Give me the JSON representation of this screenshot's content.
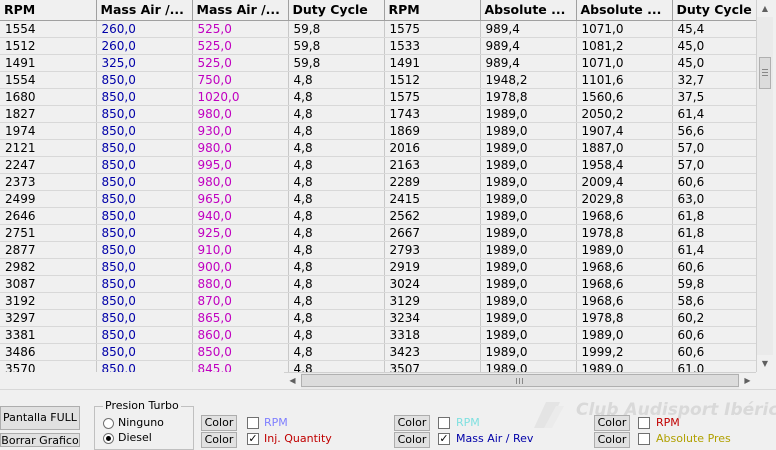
{
  "columns": [
    "RPM",
    "Mass Air /...",
    "Mass Air /...",
    "Duty Cycle",
    "RPM",
    "Absolute ...",
    "Absolute ...",
    "Duty Cycle"
  ],
  "rows": [
    [
      "1554",
      "260,0",
      "525,0",
      "59,8",
      "1575",
      "989,4",
      "1071,0",
      "45,4"
    ],
    [
      "1512",
      "260,0",
      "525,0",
      "59,8",
      "1533",
      "989,4",
      "1081,2",
      "45,0"
    ],
    [
      "1491",
      "325,0",
      "525,0",
      "59,8",
      "1491",
      "989,4",
      "1071,0",
      "45,0"
    ],
    [
      "1554",
      "850,0",
      "750,0",
      "4,8",
      "1512",
      "1948,2",
      "1101,6",
      "32,7"
    ],
    [
      "1680",
      "850,0",
      "1020,0",
      "4,8",
      "1575",
      "1978,8",
      "1560,6",
      "37,5"
    ],
    [
      "1827",
      "850,0",
      "980,0",
      "4,8",
      "1743",
      "1989,0",
      "2050,2",
      "61,4"
    ],
    [
      "1974",
      "850,0",
      "930,0",
      "4,8",
      "1869",
      "1989,0",
      "1907,4",
      "56,6"
    ],
    [
      "2121",
      "850,0",
      "980,0",
      "4,8",
      "2016",
      "1989,0",
      "1887,0",
      "57,0"
    ],
    [
      "2247",
      "850,0",
      "995,0",
      "4,8",
      "2163",
      "1989,0",
      "1958,4",
      "57,0"
    ],
    [
      "2373",
      "850,0",
      "980,0",
      "4,8",
      "2289",
      "1989,0",
      "2009,4",
      "60,6"
    ],
    [
      "2499",
      "850,0",
      "965,0",
      "4,8",
      "2415",
      "1989,0",
      "2029,8",
      "63,0"
    ],
    [
      "2646",
      "850,0",
      "940,0",
      "4,8",
      "2562",
      "1989,0",
      "1968,6",
      "61,8"
    ],
    [
      "2751",
      "850,0",
      "925,0",
      "4,8",
      "2667",
      "1989,0",
      "1978,8",
      "61,8"
    ],
    [
      "2877",
      "850,0",
      "910,0",
      "4,8",
      "2793",
      "1989,0",
      "1989,0",
      "61,4"
    ],
    [
      "2982",
      "850,0",
      "900,0",
      "4,8",
      "2919",
      "1989,0",
      "1968,6",
      "60,6"
    ],
    [
      "3087",
      "850,0",
      "880,0",
      "4,8",
      "3024",
      "1989,0",
      "1968,6",
      "59,8"
    ],
    [
      "3192",
      "850,0",
      "870,0",
      "4,8",
      "3129",
      "1989,0",
      "1968,6",
      "58,6"
    ],
    [
      "3297",
      "850,0",
      "865,0",
      "4,8",
      "3234",
      "1989,0",
      "1978,8",
      "60,2"
    ],
    [
      "3381",
      "850,0",
      "860,0",
      "4,8",
      "3318",
      "1989,0",
      "1989,0",
      "60,6"
    ],
    [
      "3486",
      "850,0",
      "850,0",
      "4,8",
      "3423",
      "1989,0",
      "1999,2",
      "60,6"
    ],
    [
      "3570",
      "850,0",
      "845,0",
      "4,8",
      "3507",
      "1989,0",
      "1989,0",
      "61,0"
    ]
  ],
  "column_colors": [
    "#000000",
    "#0000a8",
    "#c000c0",
    "#000000",
    "#000000",
    "#000000",
    "#000000",
    "#000000"
  ],
  "panel": {
    "pantalla_full": "Pantalla  FULL",
    "borrar_graficos": "Borrar Grafico",
    "presion_turbo": {
      "legend": "Presion Turbo",
      "options": [
        "Ninguno",
        "Diesel"
      ],
      "selected": "Diesel"
    },
    "series_controls": [
      {
        "color_button": "Color",
        "label": "RPM",
        "checked": false,
        "label_color": "#7f7fff"
      },
      {
        "color_button": "Color",
        "label": "Inj. Quantity",
        "checked": true,
        "label_color": "#c00000"
      },
      {
        "color_button": "Color",
        "label": "RPM",
        "checked": false,
        "label_color": "#80e0e0"
      },
      {
        "color_button": "Color",
        "label": "Mass Air / Rev",
        "checked": true,
        "label_color": "#0000a8"
      },
      {
        "color_button": "Color",
        "label": "RPM",
        "checked": false,
        "label_color": "#c00000"
      },
      {
        "color_button": "Color",
        "label": "Absolute Pres",
        "checked": false,
        "label_color": "#b0a000"
      }
    ]
  },
  "watermark": "Club Audisport Ibérica"
}
